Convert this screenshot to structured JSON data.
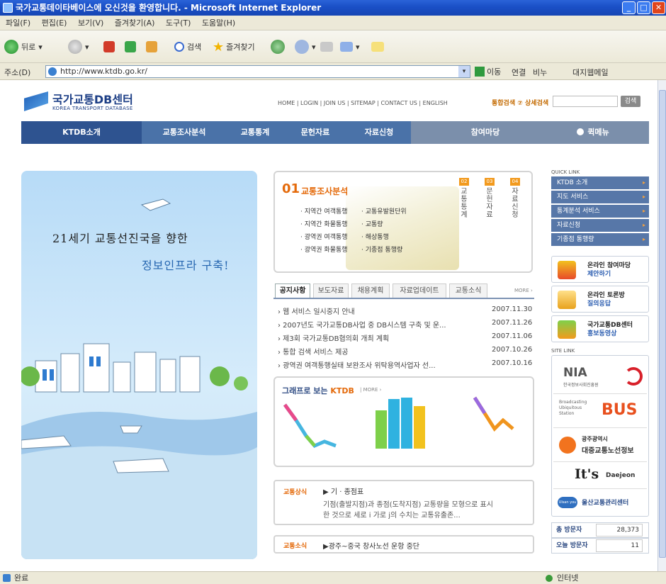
{
  "window": {
    "title": "국가교통데이타베이스에 오신것을 환영합니다. - Microsoft Internet Explorer",
    "menu": [
      "파일(F)",
      "편집(E)",
      "보기(V)",
      "즐겨찾기(A)",
      "도구(T)",
      "도움말(H)"
    ]
  },
  "toolbar": {
    "back": "뒤로",
    "search": "검색",
    "favorites": "즐겨찾기"
  },
  "addressbar": {
    "label": "주소(D)",
    "url": "http://www.ktdb.go.kr/",
    "go": "이동",
    "links_label": "연결",
    "link1": "비누",
    "link2": "대지웹메일"
  },
  "site": {
    "logo_ko": "국가교통DB센터",
    "logo_en": "KOREA TRANSPORT DATABASE",
    "topnav": "HOME  |  LOGIN  |  JOIN US  |  SITEMAP  |  CONTACT US  |  ENGLISH",
    "search_label": "통합검색 ⑦ 상세검색",
    "search_button": "검색"
  },
  "mainnav": [
    "KTDB소개",
    "교통조사분석",
    "교통통계",
    "문헌자료",
    "자료신청",
    "참여마당",
    "퀵메뉴"
  ],
  "banner": {
    "line1": "21세기 교통선진국을 향한",
    "line2": "정보인프라 구축!"
  },
  "box01": {
    "number": "01",
    "title": "교통조사분석",
    "links_left": [
      "지역간 여객통행",
      "지역간 화물통행",
      "광역권 여객통행",
      "광역권 화물통행"
    ],
    "links_right": [
      "교통유발원단위",
      "교통량",
      "해상통행",
      "기종점 통행량"
    ],
    "vtabs": [
      {
        "num": "02",
        "label": "교통통계"
      },
      {
        "num": "03",
        "label": "문헌자료"
      },
      {
        "num": "04",
        "label": "자료신청"
      }
    ]
  },
  "notice": {
    "tabs": [
      "공지사항",
      "보도자료",
      "채용계획",
      "자료업데이트",
      "교통소식"
    ],
    "more": "MORE ›",
    "items": [
      {
        "title": "› 웹 서비스 일시중지 안내",
        "date": "2007.11.30"
      },
      {
        "title": "› 2007년도 국가교통DB사업 중 DB시스템 구축 및 운...",
        "date": "2007.11.26"
      },
      {
        "title": "› 제3회 국가교통DB협의회 개최 계획",
        "date": "2007.11.06"
      },
      {
        "title": "› 통합 검색 서비스 제공",
        "date": "2007.10.26"
      },
      {
        "title": "› 광역권 여객통행실태 보완조사 위탁용역사업자 선...",
        "date": "2007.10.16"
      }
    ]
  },
  "graph": {
    "title_prefix": "그래프로 보는 ",
    "title_accent": "KTDB",
    "more": "| MORE ›"
  },
  "traffic_info": {
    "label": "교통상식",
    "heading": "▶ 기 · 종점표",
    "body1": "기점(출발지점)과 종점(도착지점) 교통량을 모형으로 표시",
    "body2": "한 것으로 세로 i 가로 j의 수치는 교통유출존..."
  },
  "traffic_news": {
    "label": "교통소식",
    "text": "▶광주~중국 창사노선 운항 중단"
  },
  "quick": {
    "title": "QUICK LINK",
    "links": [
      "KTDB 소개",
      "지도 서비스",
      "통계분석 서비스",
      "자료신청",
      "기종점 통행량"
    ]
  },
  "promo": [
    {
      "t1": "온라인 참여마당",
      "t2": "제안하기"
    },
    {
      "t1": "온라인 토론방",
      "t2": "질의응답"
    },
    {
      "t1": "국가교통DB센터",
      "t2": "홍보동영상"
    }
  ],
  "sitelink": {
    "title": "SITE LINK",
    "nia": "NIA",
    "nia_sub": "한국정보사회진흥원",
    "bus_small": "Broadcasting Ubiquitous Station",
    "bus": "BUS",
    "gwangju1": "광주광역시",
    "gwangju2": "대중교통노선정보",
    "daejeon": "It's",
    "daejeon2": "Daejeon",
    "ulsan_brand": "Ulsan you",
    "ulsan": "울산교통관리센터"
  },
  "stats": [
    {
      "label": "총 방문자",
      "value": "28,373"
    },
    {
      "label": "오늘 방문자",
      "value": "11"
    }
  ],
  "statusbar": {
    "left": "완료",
    "right": "인터넷"
  },
  "colors": {
    "title_blue": "#1a4fc6",
    "nav_blue": "#4a72a8",
    "accent_orange": "#e46a0b"
  }
}
